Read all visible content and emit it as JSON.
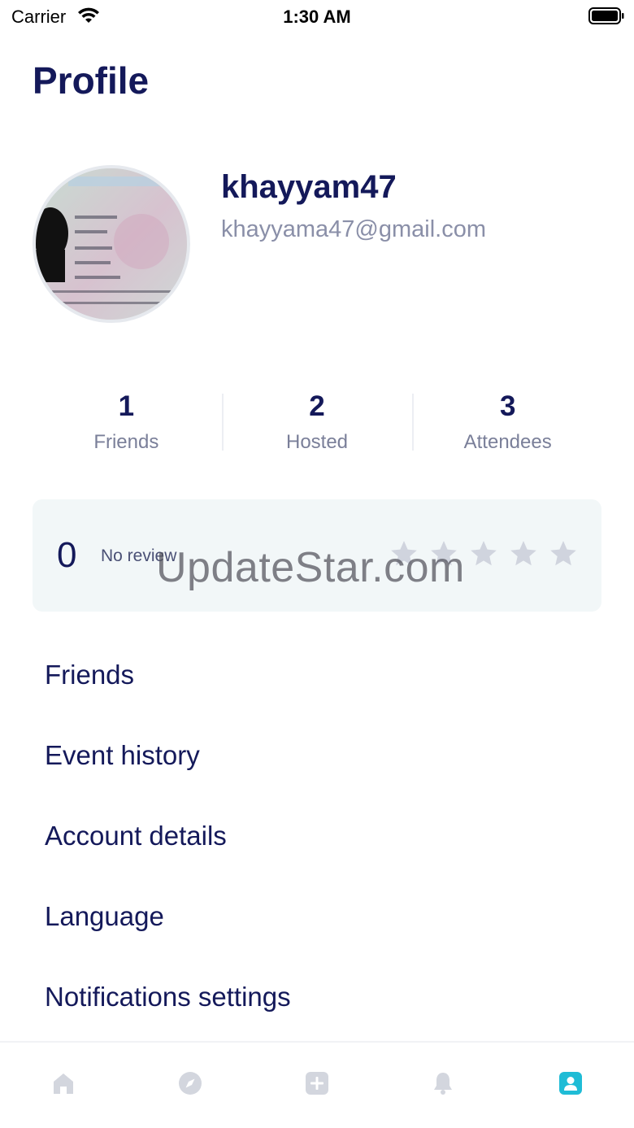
{
  "status_bar": {
    "carrier": "Carrier",
    "time": "1:30 AM"
  },
  "header": {
    "title": "Profile"
  },
  "profile": {
    "username": "khayyam47",
    "email": "khayyama47@gmail.com"
  },
  "stats": [
    {
      "value": "1",
      "label": "Friends"
    },
    {
      "value": "2",
      "label": "Hosted"
    },
    {
      "value": "3",
      "label": "Attendees"
    }
  ],
  "review": {
    "score": "0",
    "text": "No review",
    "rating": 0,
    "max_rating": 5
  },
  "watermark": "UpdateStar.com",
  "menu": [
    {
      "label": "Friends"
    },
    {
      "label": "Event history"
    },
    {
      "label": "Account details"
    },
    {
      "label": "Language"
    },
    {
      "label": "Notifications settings"
    }
  ],
  "tabbar": {
    "items": [
      "home-icon",
      "compass-icon",
      "add-icon",
      "bell-icon",
      "profile-icon"
    ],
    "active": "profile-icon"
  },
  "colors": {
    "primary_text": "#14195a",
    "secondary_text": "#8a8fa8",
    "accent": "#1fbcd6",
    "inactive_icon": "#d3d6de",
    "review_bg": "#f2f7f8"
  }
}
